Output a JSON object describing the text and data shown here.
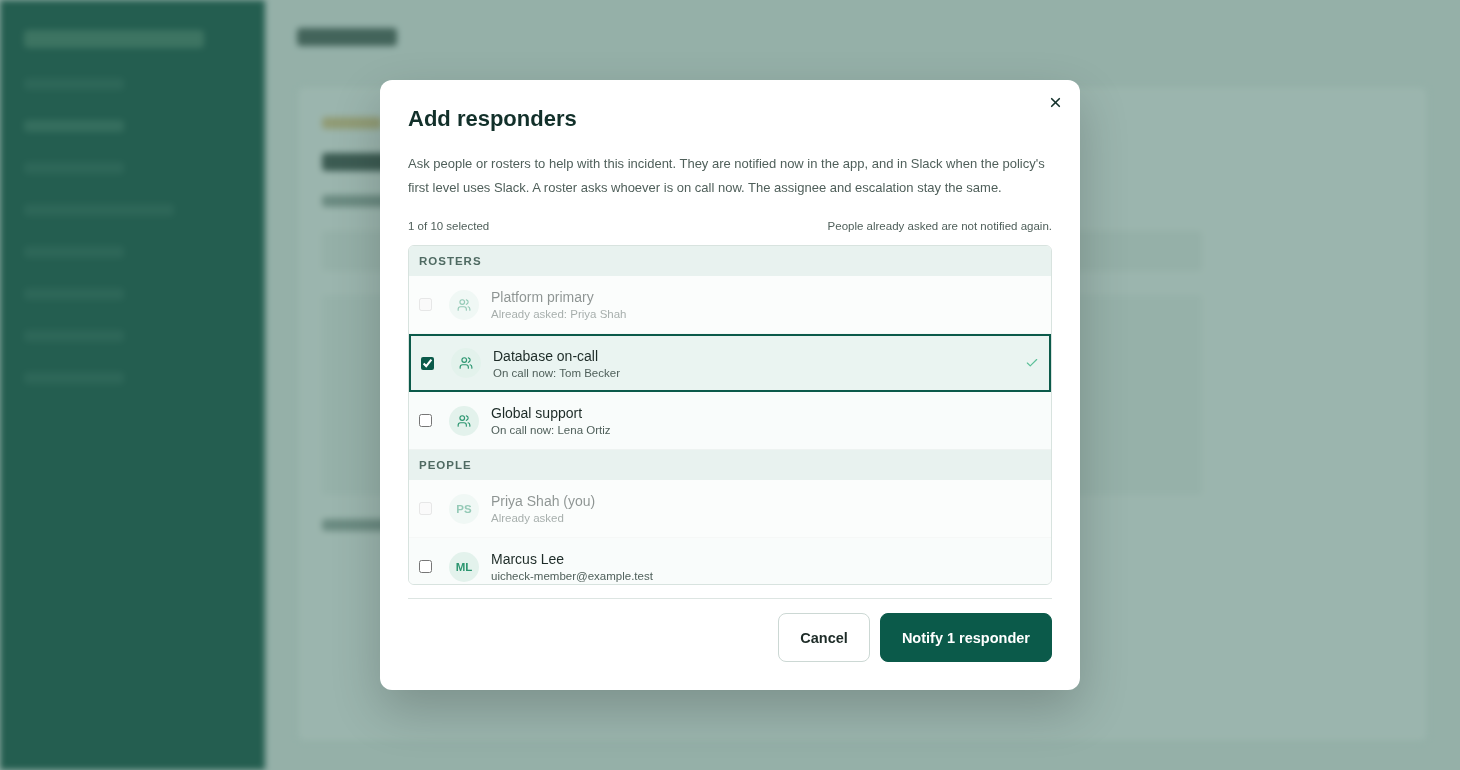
{
  "dialog": {
    "title": "Add responders",
    "description": "Ask people or rosters to help with this incident. They are notified now in the app, and in Slack when the policy's first level uses Slack. A roster asks whoever is on call now. The assignee and escalation stay the same.",
    "selection_count": "1 of 10 selected",
    "note": "People already asked are not notified again.",
    "sections": [
      {
        "heading": "ROSTERS",
        "items": [
          {
            "kind": "roster",
            "name": "Platform primary",
            "detail": "Already asked: Priya Shah",
            "checked": false,
            "disabled": true,
            "selected": false
          },
          {
            "kind": "roster",
            "name": "Database on-call",
            "detail": "On call now: Tom Becker",
            "checked": true,
            "disabled": false,
            "selected": true
          },
          {
            "kind": "roster",
            "name": "Global support",
            "detail": "On call now: Lena Ortiz",
            "checked": false,
            "disabled": false,
            "selected": false
          }
        ]
      },
      {
        "heading": "PEOPLE",
        "items": [
          {
            "kind": "person",
            "initials": "PS",
            "name": "Priya Shah (you)",
            "detail": "Already asked",
            "checked": false,
            "disabled": true,
            "selected": false
          },
          {
            "kind": "person",
            "initials": "ML",
            "name": "Marcus Lee",
            "detail": "uicheck-member@example.test",
            "checked": false,
            "disabled": false,
            "selected": false
          }
        ]
      }
    ],
    "buttons": [
      {
        "kind": "secondary",
        "label": "Cancel"
      },
      {
        "kind": "primary",
        "label": "Notify 1 responder"
      }
    ]
  }
}
